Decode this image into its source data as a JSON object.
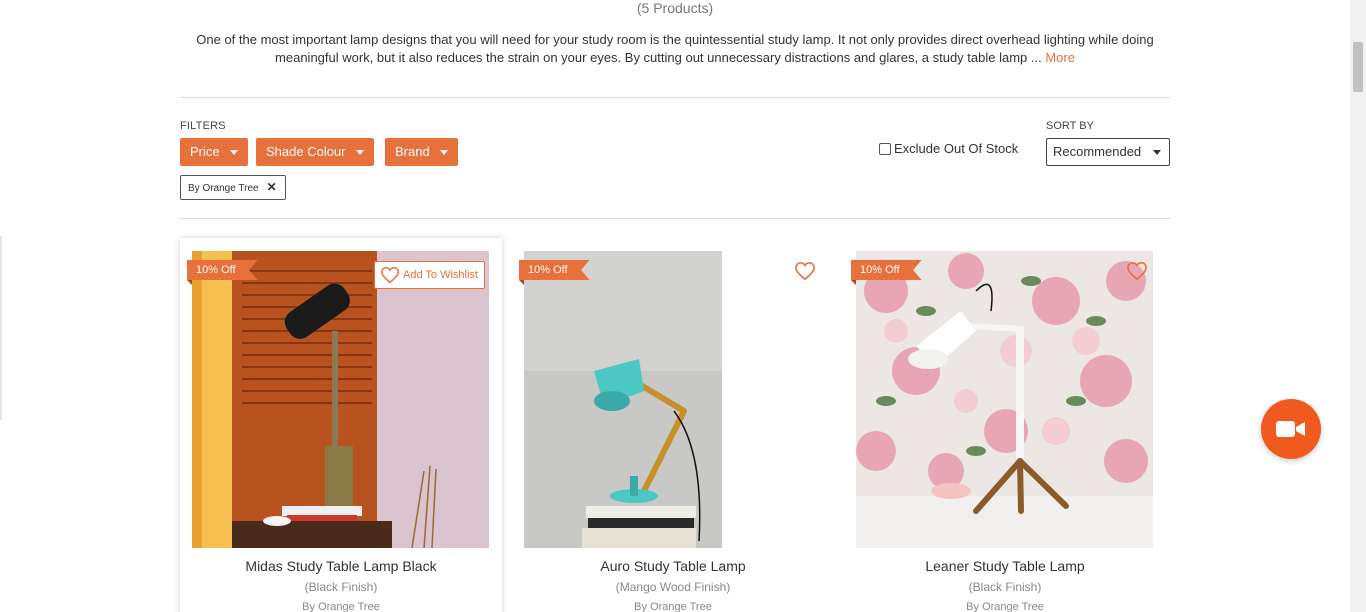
{
  "header": {
    "products_count": "(5 Products)",
    "description": "One of the most important lamp designs that you will need for your study room is the quintessential study lamp. It not only provides direct overhead lighting while doing meaningful work, but it also reduces the strain on your eyes. By cutting out unnecessary distractions and glares, a study table lamp ... ",
    "more_label": "More"
  },
  "filters": {
    "label": "FILTERS",
    "buttons": [
      "Price",
      "Shade Colour",
      "Brand"
    ],
    "active_chip": "By Orange Tree",
    "exclude_label": "Exclude Out Of Stock"
  },
  "sort": {
    "label": "SORT BY",
    "selected": "Recommended"
  },
  "products": [
    {
      "badge": "10% Off",
      "title": "Midas Study Table Lamp Black",
      "finish": "(Black Finish)",
      "brand": "By Orange Tree",
      "wishlist_label": "Add To Wishlist"
    },
    {
      "badge": "10% Off",
      "title": "Auro Study Table Lamp",
      "finish": "(Mango Wood Finish)",
      "brand": "By Orange Tree"
    },
    {
      "badge": "10% Off",
      "title": "Leaner Study Table Lamp",
      "finish": "(Black Finish)",
      "brand": "By Orange Tree"
    }
  ],
  "colors": {
    "accent": "#e8703a",
    "fab": "#f05a1e"
  },
  "icons": {
    "wishlist": "heart-outline-icon",
    "remove_filter": "close-icon",
    "dropdown": "caret-down-icon",
    "video_call": "video-camera-icon"
  }
}
